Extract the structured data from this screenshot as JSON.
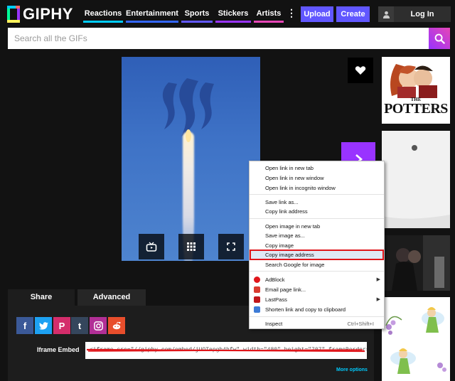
{
  "header": {
    "logo_text": "GIPHY",
    "nav": [
      "Reactions",
      "Entertainment",
      "Sports",
      "Stickers",
      "Artists"
    ],
    "more_glyph": "⋮",
    "upload_label": "Upload",
    "create_label": "Create",
    "login_label": "Log In"
  },
  "search": {
    "placeholder": "Search all the GIFs"
  },
  "thumbs": {
    "potters_the": "THE",
    "potters_title": "POTTERS"
  },
  "share": {
    "tabs": [
      "Share",
      "Advanced"
    ],
    "social": [
      "f",
      "t",
      "P",
      "t",
      "ig",
      "r"
    ],
    "iframe_label": "Iframe Embed",
    "iframe_value": "<iframe src=\"//giphy.com/embed/jUOTepgh4hfw\" width=\"480\" height=\"707\" frameBorder=\"0\" class=\"giphy-e",
    "more_options": "More options"
  },
  "context_menu": {
    "items": [
      "Open link in new tab",
      "Open link in new window",
      "Open link in incognito window",
      "Save link as...",
      "Copy link address",
      "Open image in new tab",
      "Save image as...",
      "Copy image",
      "Copy image address",
      "Search Google for image",
      "AdBlock",
      "Email page link...",
      "LastPass",
      "Shorten link and copy to clipboard",
      "Inspect"
    ],
    "inspect_shortcut": "Ctrl+Shift+I",
    "highlighted_item": "Copy image address"
  },
  "colors": {
    "accent_purple": "#6157ff",
    "highlight_red": "#e0161b"
  }
}
